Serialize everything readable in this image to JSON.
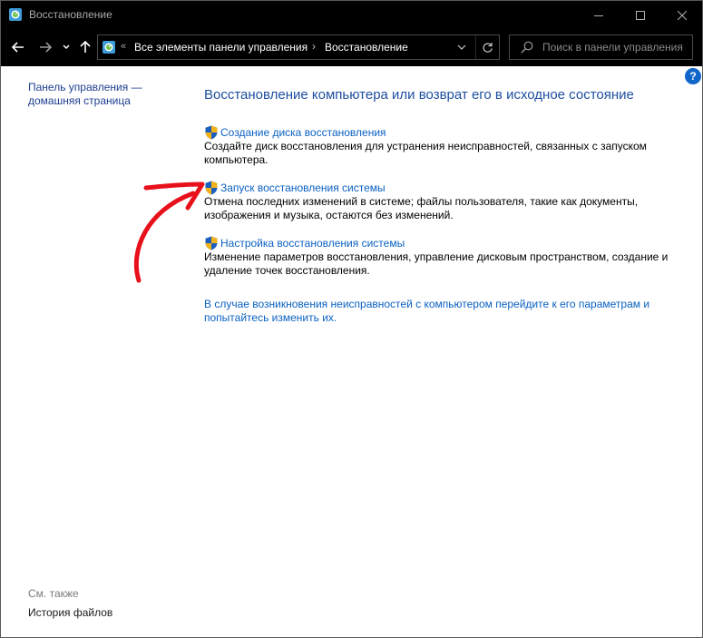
{
  "window": {
    "title": "Восстановление"
  },
  "nav": {
    "breadcrumbs": [
      "Все элементы панели управления",
      "Восстановление"
    ],
    "search_placeholder": "Поиск в панели управления"
  },
  "sidebar": {
    "home_link": "Панель управления — домашняя страница",
    "see_also_label": "См. также",
    "see_also_items": [
      "История файлов"
    ]
  },
  "main": {
    "title": "Восстановление компьютера или возврат его в исходное состояние",
    "tasks": [
      {
        "label": "Создание диска восстановления",
        "description": "Создайте диск восстановления для устранения неисправностей, связанных с запуском компьютера."
      },
      {
        "label": "Запуск восстановления системы",
        "description": "Отмена последних изменений в системе; файлы пользователя, такие как документы, изображения и музыка, остаются без изменений."
      },
      {
        "label": "Настройка восстановления системы",
        "description": "Изменение параметров восстановления, управление дисковым пространством, создание и удаление точек восстановления."
      }
    ],
    "footer_link": "В случае возникновения неисправностей с компьютером перейдите к его параметрам и попытайтесь изменить их."
  },
  "icons": {
    "app": "control-panel-recovery-icon",
    "task": "uac-shield-icon",
    "help": "help-icon"
  },
  "colors": {
    "link": "#0b61c2",
    "title": "#1e4fa0",
    "annotation_arrow": "#e8101a"
  }
}
